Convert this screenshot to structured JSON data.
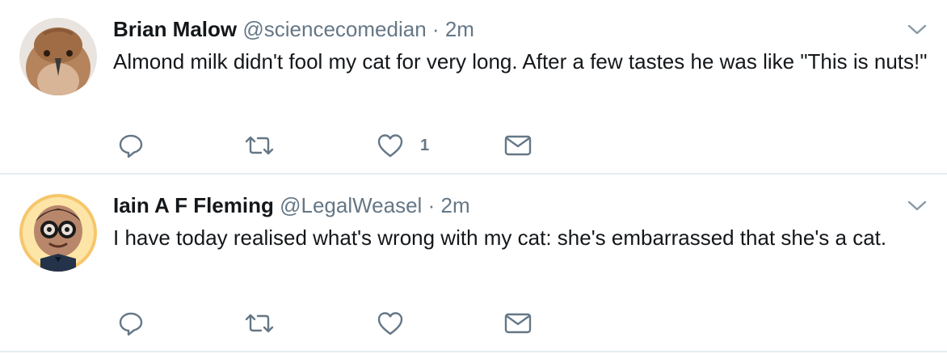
{
  "tweets": [
    {
      "name": "Brian Malow",
      "handle": "@sciencecomedian",
      "separator": "·",
      "time": "2m",
      "text": "Almond milk didn't fool my cat for very long. After a few tastes he was like \"This is nuts!\"",
      "like_count": "1",
      "avatar": "bird-avatar"
    },
    {
      "name": "Iain A F Fleming",
      "handle": "@LegalWeasel",
      "separator": "·",
      "time": "2m",
      "text": "I have today realised what's wrong with my cat: she's embarrassed that she's a cat.",
      "like_count": "",
      "avatar": "cartoon-glasses-avatar"
    }
  ],
  "icons": [
    "reply-icon",
    "retweet-icon",
    "like-icon",
    "direct-message-icon",
    "chevron-down-icon"
  ],
  "colors": {
    "text": "#14171a",
    "secondary": "#657786",
    "divider": "#e6ecf0"
  }
}
